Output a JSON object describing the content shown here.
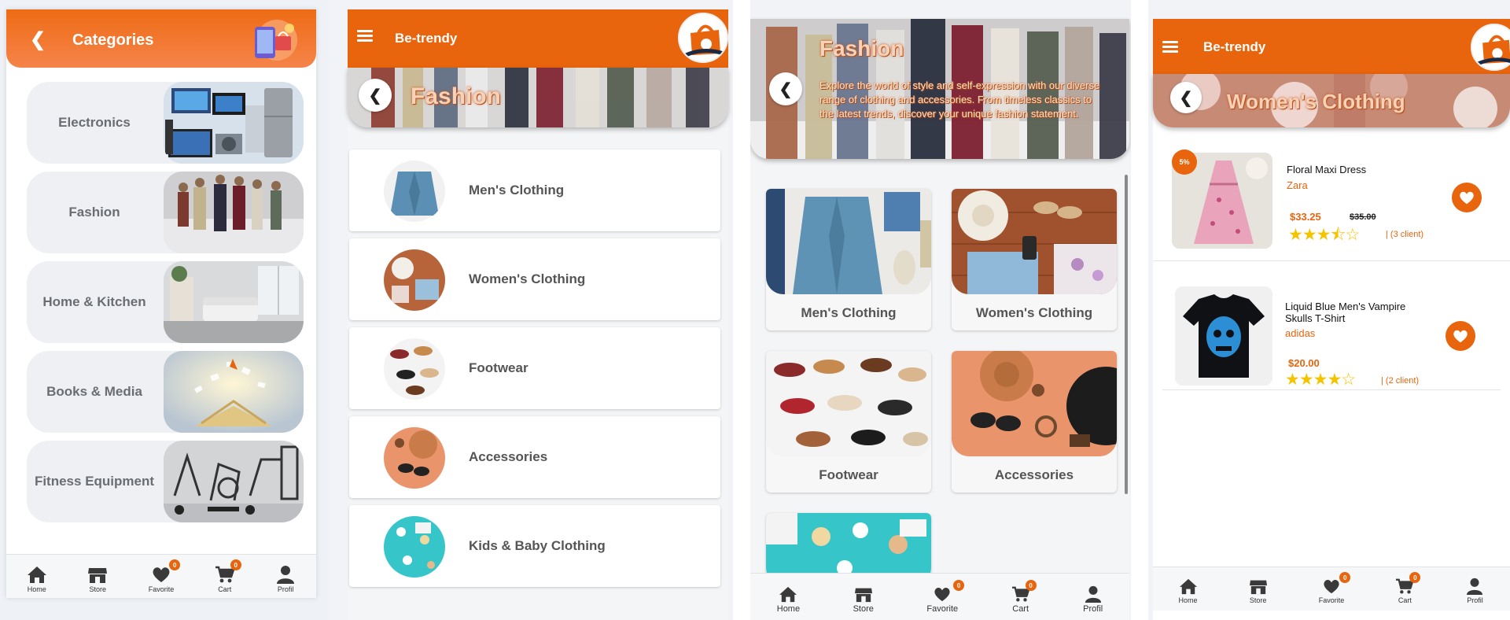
{
  "panel1": {
    "header_title": "Categories",
    "back_icon": "chevron-left-icon",
    "categories": [
      {
        "label": "Electronics"
      },
      {
        "label": "Fashion"
      },
      {
        "label": "Home & Kitchen"
      },
      {
        "label": "Books & Media"
      },
      {
        "label": "Fitness Equipment"
      }
    ]
  },
  "panel2": {
    "brand": "Be-trendy",
    "hero_title": "Fashion",
    "items": [
      {
        "label": "Men's Clothing"
      },
      {
        "label": "Women's Clothing"
      },
      {
        "label": "Footwear"
      },
      {
        "label": "Accessories"
      },
      {
        "label": "Kids & Baby Clothing"
      }
    ]
  },
  "panel3": {
    "hero_title": "Fashion",
    "hero_description": "Explore the world of style and self-expression with our diverse range of clothing and accessories. From timeless classics to the latest trends, discover your unique fashion statement.",
    "cards": [
      {
        "label": "Men's Clothing"
      },
      {
        "label": "Women's Clothing"
      },
      {
        "label": "Footwear"
      },
      {
        "label": "Accessories"
      }
    ]
  },
  "panel4": {
    "brand": "Be-trendy",
    "hero_title": "Women's Clothing",
    "products": [
      {
        "name": "Floral Maxi Dress",
        "brand": "Zara",
        "price": "$33.25",
        "old_price": "$35.00",
        "discount": "5%",
        "rating": 3.5,
        "stars": "★★★⯪☆",
        "clients": "| (3 client)"
      },
      {
        "name": "Liquid Blue Men's Vampire Skulls T-Shirt",
        "brand": "adidas",
        "price": "$20.00",
        "rating": 4,
        "stars": "★★★★☆",
        "clients": "| (2 client)"
      }
    ]
  },
  "nav": {
    "home": "Home",
    "store": "Store",
    "favorite": "Favorite",
    "cart": "Cart",
    "profil": "Profil",
    "favorite_count": "0",
    "cart_count": "0"
  },
  "colors": {
    "accent": "#e8640d",
    "star": "#f5c400"
  }
}
